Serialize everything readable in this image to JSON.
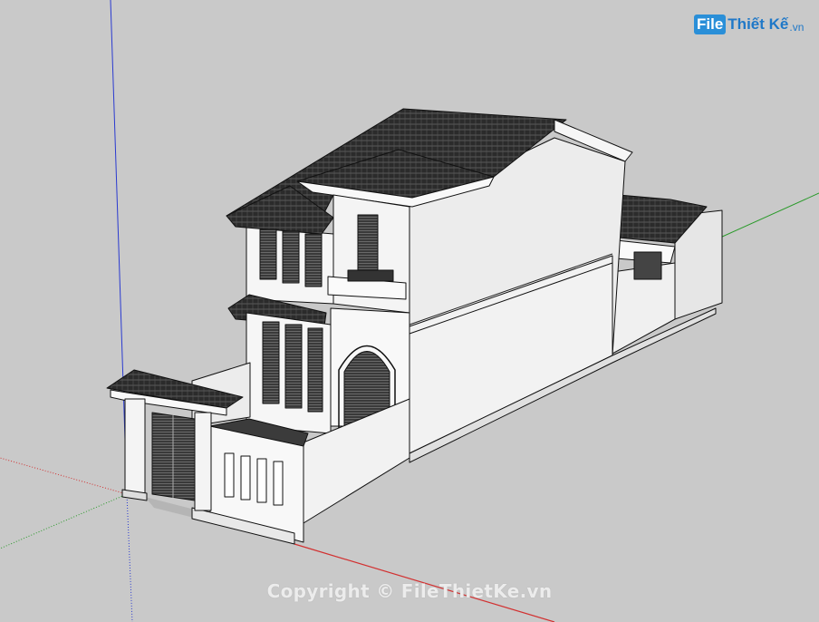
{
  "logo": {
    "box_text": "File",
    "main_text": "Thiết Kế",
    "domain_text": ".vn",
    "color": "#2a8fd8"
  },
  "watermark": {
    "text": "Copyright © FileThietKe.vn"
  },
  "scene": {
    "background_color": "#c9c9c9",
    "axis_colors": {
      "red": "#d23030",
      "green": "#2a9a2a",
      "blue": "#2a3ad0"
    },
    "roof_color": "#2b2b2b",
    "wall_color": "#f4f4f4",
    "shadow_wall_color": "#e2e2e2"
  }
}
